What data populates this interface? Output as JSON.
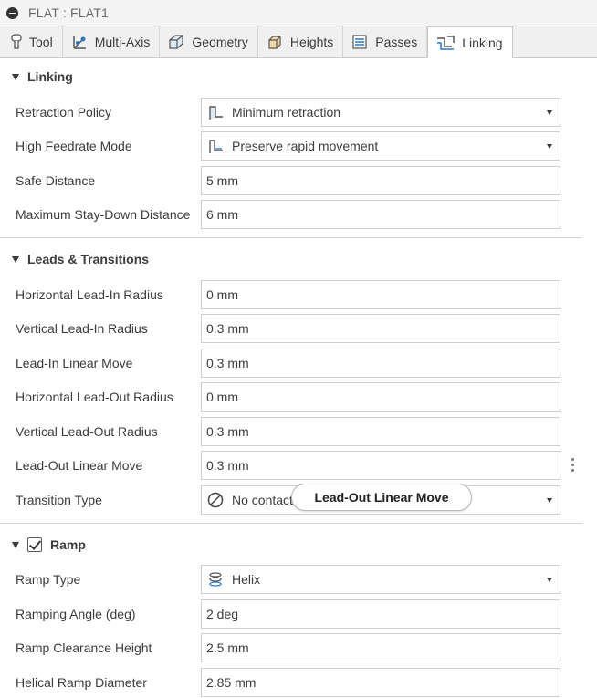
{
  "window": {
    "title": "FLAT : FLAT1"
  },
  "tabs": [
    {
      "label": "Tool",
      "icon": "tool-icon"
    },
    {
      "label": "Multi-Axis",
      "icon": "multi-axis-icon"
    },
    {
      "label": "Geometry",
      "icon": "geometry-icon"
    },
    {
      "label": "Heights",
      "icon": "heights-icon"
    },
    {
      "label": "Passes",
      "icon": "passes-icon"
    },
    {
      "label": "Linking",
      "icon": "linking-icon",
      "active": true
    }
  ],
  "linking": {
    "header": "Linking",
    "retraction_policy": {
      "label": "Retraction Policy",
      "value": "Minimum retraction"
    },
    "high_feedrate_mode": {
      "label": "High Feedrate Mode",
      "value": "Preserve rapid movement"
    },
    "safe_distance": {
      "label": "Safe Distance",
      "value": "5 mm"
    },
    "max_stay_down": {
      "label": "Maximum Stay-Down Distance",
      "value": "6 mm"
    }
  },
  "leads": {
    "header": "Leads & Transitions",
    "h_lead_in_radius": {
      "label": "Horizontal Lead-In Radius",
      "value": "0 mm"
    },
    "v_lead_in_radius": {
      "label": "Vertical Lead-In Radius",
      "value": "0.3 mm"
    },
    "lead_in_linear": {
      "label": "Lead-In Linear Move",
      "value": "0.3 mm"
    },
    "h_lead_out_radius": {
      "label": "Horizontal Lead-Out Radius",
      "value": "0 mm"
    },
    "v_lead_out_radius": {
      "label": "Vertical Lead-Out Radius",
      "value": "0.3 mm"
    },
    "lead_out_linear": {
      "label": "Lead-Out Linear Move",
      "value": "0.3 mm"
    },
    "transition_type": {
      "label": "Transition Type",
      "value": "No contact"
    },
    "tooltip": "Lead-Out Linear Move"
  },
  "ramp": {
    "header": "Ramp",
    "enabled": true,
    "ramp_type": {
      "label": "Ramp Type",
      "value": "Helix"
    },
    "ramping_angle": {
      "label": "Ramping Angle (deg)",
      "value": "2 deg"
    },
    "clearance_height": {
      "label": "Ramp Clearance Height",
      "value": "2.5 mm"
    },
    "helical_diameter": {
      "label": "Helical Ramp Diameter",
      "value": "2.85 mm"
    }
  },
  "colors": {
    "accent": "#2b78c2",
    "border": "#cfcfcf",
    "text": "#3c3c3c"
  }
}
